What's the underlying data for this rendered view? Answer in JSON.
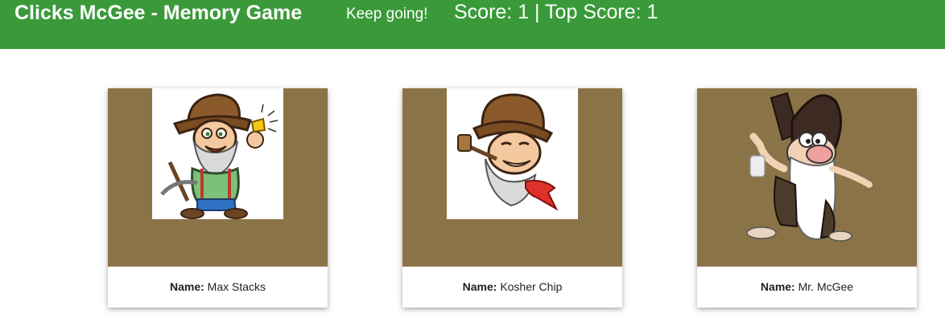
{
  "header": {
    "title": "Clicks McGee - Memory Game",
    "status": "Keep going!",
    "score_text": "Score: 1 | Top Score: 1"
  },
  "cards": [
    {
      "name_label": "Name:",
      "name": "Max Stacks",
      "image": "prospector-with-gold-nugget-image"
    },
    {
      "name_label": "Name:",
      "name": "Kosher Chip",
      "image": "prospector-with-pipe-image"
    },
    {
      "name_label": "Name:",
      "name": "Mr. McGee",
      "image": "old-prospector-pointing-image"
    }
  ],
  "colors": {
    "navbar": "#3a9a39",
    "card_image_bg": "#8b7348",
    "text": "#222222"
  }
}
